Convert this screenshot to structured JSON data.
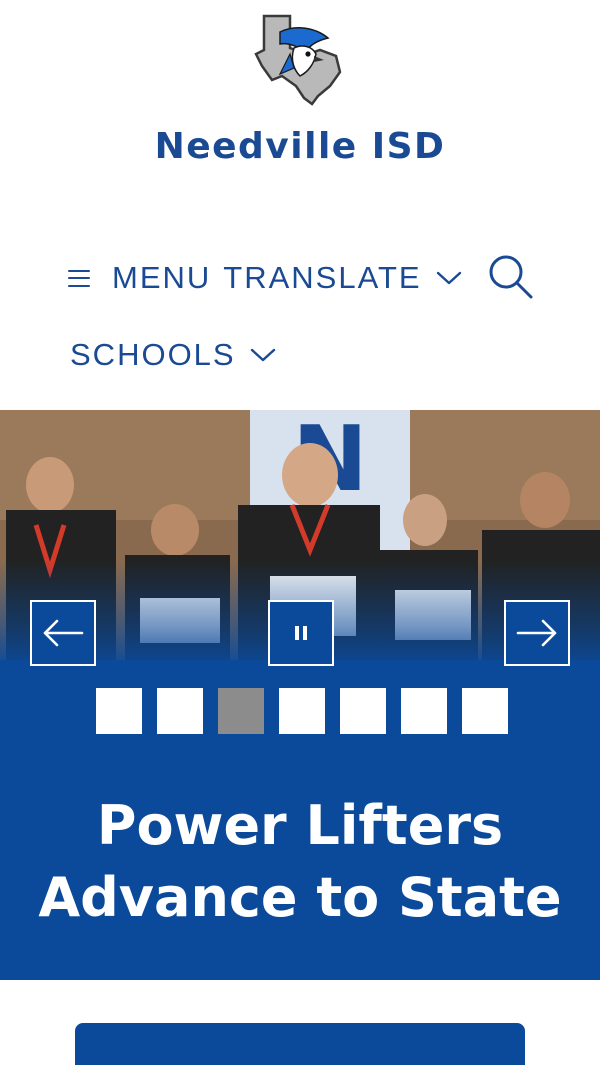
{
  "header": {
    "logo_name": "needville-bluejay-texas-logo",
    "site_title": "Needville ISD"
  },
  "nav": {
    "menu_label": "MENU",
    "translate_label": "TRANSLATE",
    "schools_label": "SCHOOLS",
    "icons": [
      "hamburger-icon",
      "chevron-down-icon",
      "search-icon"
    ]
  },
  "slider": {
    "headline": "Power Lifters Advance to State",
    "slide_count": 7,
    "active_slide": 3,
    "colors": {
      "panel": "#0b4a9a",
      "dot": "#ffffff",
      "dot_active": "#8c8c8c"
    },
    "controls": [
      "arrow-left-icon",
      "pause-icon",
      "arrow-right-icon"
    ]
  },
  "colors": {
    "brand_blue": "#1a4a93",
    "background": "#ffffff"
  }
}
